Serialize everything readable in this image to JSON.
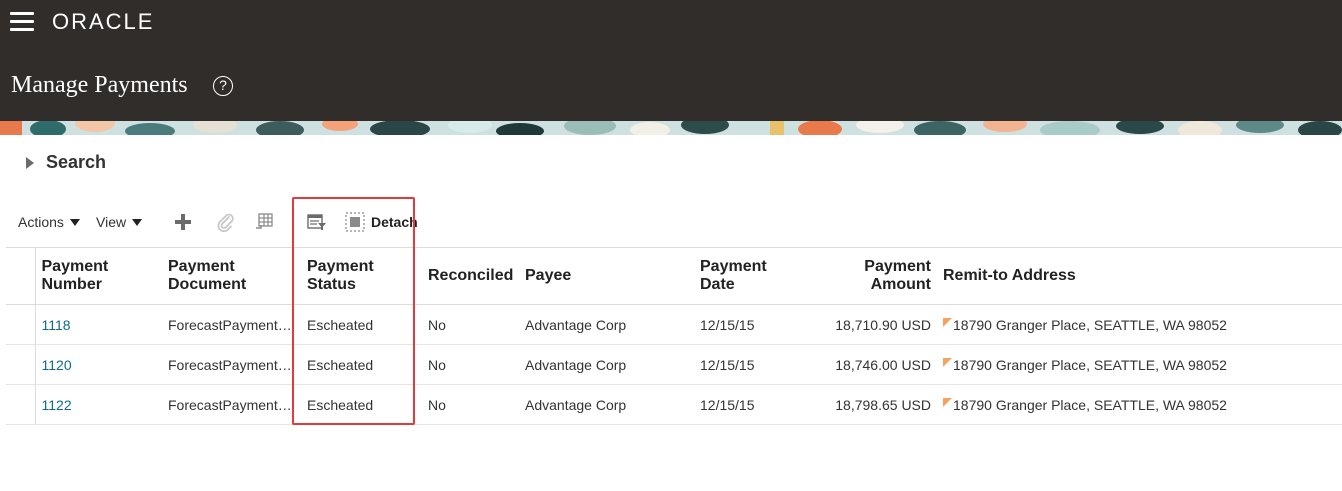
{
  "header": {
    "logo_text": "ORACLE",
    "page_title": "Manage Payments",
    "help_symbol": "?"
  },
  "search": {
    "label": "Search"
  },
  "toolbar": {
    "actions_label": "Actions",
    "view_label": "View",
    "detach_label": "Detach",
    "icons": [
      "add-icon",
      "attach-icon",
      "freeze-columns-icon",
      "query-by-example-icon",
      "detach-icon"
    ]
  },
  "table": {
    "headers": {
      "payment_number": [
        "Payment",
        "Number"
      ],
      "payment_document": [
        "Payment",
        "Document"
      ],
      "payment_status": [
        "Payment",
        "Status"
      ],
      "reconciled": "Reconciled",
      "payee": "Payee",
      "payment_date": [
        "Payment",
        "Date"
      ],
      "payment_amount": [
        "Payment",
        "Amount"
      ],
      "remit_to_address": "Remit-to Address"
    },
    "rows": [
      {
        "number": "1118",
        "document": "ForecastPayment…",
        "status": "Escheated",
        "reconciled": "No",
        "payee": "Advantage Corp",
        "date": "12/15/15",
        "amount": "18,710.90 USD",
        "address": "18790 Granger Place, SEATTLE, WA 98052"
      },
      {
        "number": "1120",
        "document": "ForecastPayment…",
        "status": "Escheated",
        "reconciled": "No",
        "payee": "Advantage Corp",
        "date": "12/15/15",
        "amount": "18,746.00 USD",
        "address": "18790 Granger Place, SEATTLE, WA 98052"
      },
      {
        "number": "1122",
        "document": "ForecastPayment…",
        "status": "Escheated",
        "reconciled": "No",
        "payee": "Advantage Corp",
        "date": "12/15/15",
        "amount": "18,798.65 USD",
        "address": "18790 Granger Place, SEATTLE, WA 98052"
      }
    ]
  },
  "colors": {
    "header_bg": "#312d2a",
    "link": "#0f6a8c",
    "highlight": "#e23b3b"
  }
}
